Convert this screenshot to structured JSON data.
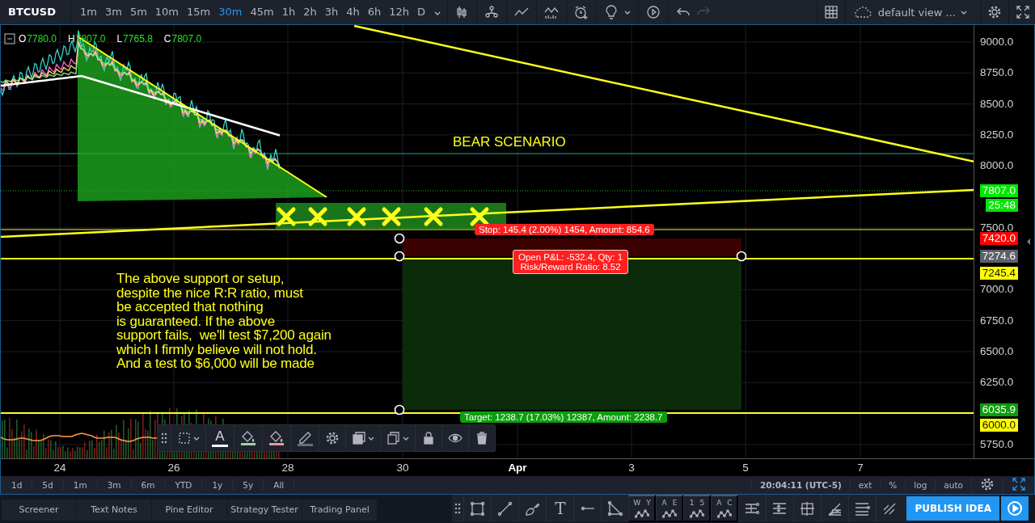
{
  "toolbar": {
    "symbol": "BTCUSD",
    "intervals": [
      {
        "label": "1m",
        "selected": false
      },
      {
        "label": "3m",
        "selected": false
      },
      {
        "label": "5m",
        "selected": false
      },
      {
        "label": "10m",
        "selected": false
      },
      {
        "label": "15m",
        "selected": false
      },
      {
        "label": "30m",
        "selected": true
      },
      {
        "label": "45m",
        "selected": false
      },
      {
        "label": "1h",
        "selected": false
      },
      {
        "label": "2h",
        "selected": false
      },
      {
        "label": "3h",
        "selected": false
      },
      {
        "label": "4h",
        "selected": false
      },
      {
        "label": "6h",
        "selected": false
      },
      {
        "label": "12h",
        "selected": false
      },
      {
        "label": "D",
        "selected": false
      }
    ],
    "layout_name": "default view ..."
  },
  "legend": [
    {
      "label": "O",
      "value": "7780.0"
    },
    {
      "label": "H",
      "value": "7807.0"
    },
    {
      "label": "L",
      "value": "7765.8"
    },
    {
      "label": "C",
      "value": "7807.0"
    }
  ],
  "chart": {
    "annotations": [
      {
        "kind": "title",
        "text": "BEAR SCENARIO"
      },
      {
        "kind": "note",
        "text": "The above support or setup,\ndespite the nice R:R ratio, must\nbe accepted that nothing\nis guaranteed. If the above\nsupport fails,  we'll test $7,200 again\nwhich I firmly believe will not hold.\nAnd a test to $6,000 will be made"
      }
    ],
    "position": {
      "stop_label": "Stop: 145.4 (2.00%) 1454, Amount: 854.6",
      "pnl_label": "Open P&L: -532.4, Qty: 1\nRisk/Reward Ratio: 8.52",
      "target_label": "Target: 1238.7 (17.03%) 12387, Amount: 2238.7"
    },
    "price_ticks": [
      "9000.0",
      "8750.0",
      "8500.0",
      "8250.0",
      "8000.0",
      "7500.0",
      "7000.0",
      "6750.0",
      "6500.0",
      "6250.0",
      "5750.0"
    ],
    "price_badges": [
      {
        "text": "7807.0",
        "color": "#00e600"
      },
      {
        "text": "25:48",
        "color": "#00e600"
      },
      {
        "text": "7420.0",
        "color": "#ff0000"
      },
      {
        "text": "7274.6",
        "color": "#5d606b"
      },
      {
        "text": "7245.4",
        "color": "#ffff00"
      },
      {
        "text": "6035.9",
        "color": "#0a9e0a"
      },
      {
        "text": "6000.0",
        "color": "#ffff00"
      }
    ],
    "time_labels": [
      {
        "text": "24",
        "kind": "day"
      },
      {
        "text": "26",
        "kind": "day"
      },
      {
        "text": "28",
        "kind": "day"
      },
      {
        "text": "30",
        "kind": "day"
      },
      {
        "text": "Apr",
        "kind": "month"
      },
      {
        "text": "3",
        "kind": "day"
      },
      {
        "text": "5",
        "kind": "day"
      },
      {
        "text": "7",
        "kind": "day"
      }
    ],
    "drawing_toolbar": {
      "text_glyph": "A"
    }
  },
  "range_buttons": [
    "1d",
    "5d",
    "1m",
    "3m",
    "6m",
    "YTD",
    "1y",
    "5y",
    "All"
  ],
  "status": [
    "20:04:11 (UTC-5)",
    "ext",
    "%",
    "log",
    "auto"
  ],
  "bottom_tabs": [
    "Screener",
    "Text Notes",
    "Pine Editor",
    "Strategy Tester",
    "Trading Panel"
  ],
  "drawing_tools": {
    "text_glyph": "T",
    "pattern_labels": [
      [
        "W",
        "Y"
      ],
      [
        "A",
        "E"
      ],
      [
        "1",
        "5"
      ],
      [
        "A",
        "C"
      ]
    ]
  },
  "publish_button": "PUBLISH IDEA"
}
